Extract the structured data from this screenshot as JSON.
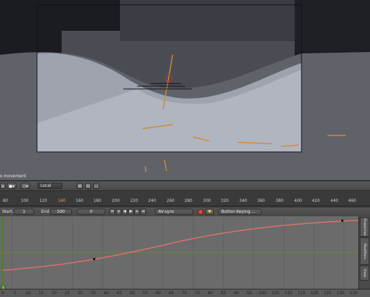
{
  "viewport": {
    "overlay_text": "o movement"
  },
  "header": {
    "orientation_label": "Local"
  },
  "frame_ruler": {
    "ticks": [
      "80",
      "100",
      "120",
      "140",
      "160",
      "180",
      "200",
      "220",
      "240",
      "260",
      "280",
      "300",
      "320",
      "340",
      "360",
      "380",
      "400",
      "420",
      "440",
      "460"
    ],
    "current_frame": "140"
  },
  "timeline": {
    "start_label": "Start:",
    "start_value": "1",
    "end_label": "End:",
    "end_value": "500",
    "current_value": "0",
    "sync_option": "AV-sync",
    "keying_label": "Button Keying ..."
  },
  "graph": {
    "tabs": [
      "Properties",
      "Modifiers",
      "View"
    ],
    "channel_value": "0"
  },
  "bottom_ruler": {
    "ticks": [
      "0",
      "5",
      "10",
      "15",
      "20",
      "25",
      "30",
      "35",
      "40",
      "45",
      "50",
      "55",
      "60",
      "65",
      "70",
      "75",
      "80",
      "85",
      "90",
      "95",
      "100",
      "105",
      "110",
      "115",
      "120",
      "125",
      "130",
      "135"
    ]
  },
  "colors": {
    "curve": "#e2706a",
    "playhead_line": "#8ab04a",
    "current_frame": "#ff9a3a"
  }
}
